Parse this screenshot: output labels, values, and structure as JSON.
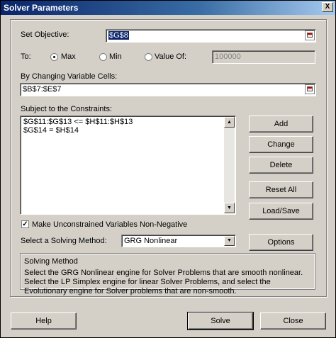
{
  "window": {
    "title": "Solver Parameters",
    "close_label": "X"
  },
  "objective": {
    "label": "Set Objective:",
    "value": "$G$8"
  },
  "to": {
    "label": "To:",
    "max_label": "Max",
    "min_label": "Min",
    "value_of_label": "Value Of:",
    "selected": "Max",
    "value_of_input": "100000"
  },
  "changing_cells": {
    "label": "By Changing Variable Cells:",
    "value": "$B$7:$E$7"
  },
  "constraints": {
    "label": "Subject to the Constraints:",
    "items": [
      "$G$11:$G$13 <= $H$11:$H$13",
      "$G$14 = $H$14"
    ]
  },
  "constraint_buttons": {
    "add": "Add",
    "change": "Change",
    "delete": "Delete",
    "reset_all": "Reset All",
    "load_save": "Load/Save"
  },
  "non_negative": {
    "label": "Make Unconstrained Variables Non-Negative",
    "checked": true
  },
  "method": {
    "label": "Select a Solving Method:",
    "value": "GRG Nonlinear",
    "options_button": "Options"
  },
  "solving_method": {
    "title": "Solving Method",
    "description": "Select the GRG Nonlinear engine for Solver Problems that are smooth nonlinear. Select the LP Simplex engine for linear Solver Problems, and select the Evolutionary engine for Solver problems that are non-smooth."
  },
  "footer": {
    "help": "Help",
    "solve": "Solve",
    "close": "Close"
  }
}
